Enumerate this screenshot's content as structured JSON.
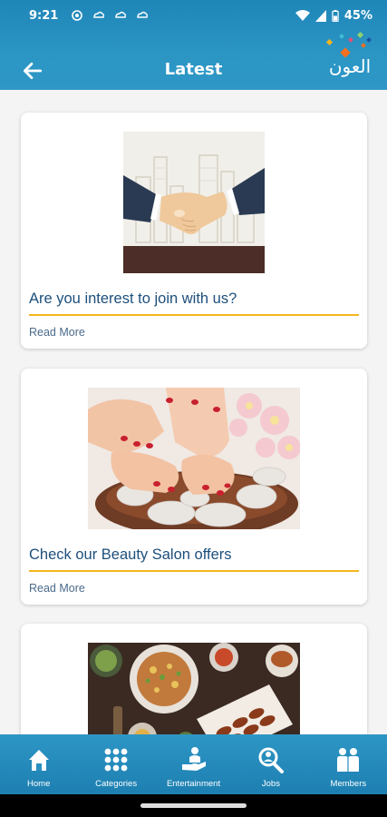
{
  "status_bar": {
    "time": "9:21",
    "battery": "45%"
  },
  "header": {
    "title": "Latest",
    "logo_text": "العون"
  },
  "cards": [
    {
      "title": "Are you interest to join with us?",
      "read_more": "Read More",
      "image": "handshake-image"
    },
    {
      "title": "Check our Beauty Salon offers",
      "read_more": "Read More",
      "image": "spa-image"
    },
    {
      "title": "",
      "read_more": "",
      "image": "food-image"
    }
  ],
  "nav": [
    {
      "label": "Home",
      "icon": "home-icon"
    },
    {
      "label": "Categories",
      "icon": "grid-icon"
    },
    {
      "label": "Entertainment",
      "icon": "entertainment-icon"
    },
    {
      "label": "Jobs",
      "icon": "jobs-icon"
    },
    {
      "label": "Members",
      "icon": "members-icon"
    }
  ],
  "colors": {
    "primary": "#2b95c4",
    "accent": "#f3b61d",
    "title": "#1d4f7c"
  }
}
